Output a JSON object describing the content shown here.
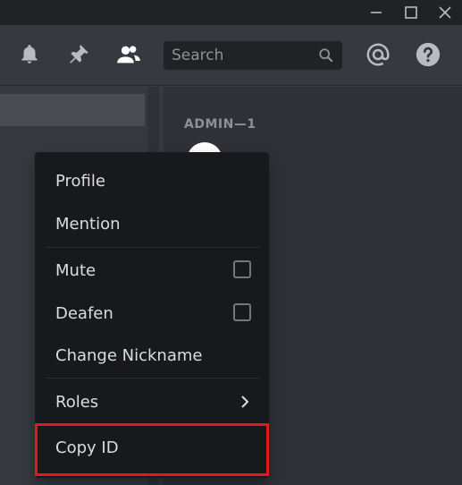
{
  "window": {
    "icons": [
      "minimize-icon",
      "maximize-icon",
      "close-icon"
    ]
  },
  "toolbar": {
    "icons": [
      "bell-icon",
      "pin-icon",
      "members-icon",
      "mention-icon",
      "help-icon"
    ],
    "search": {
      "placeholder": "Search",
      "value": ""
    }
  },
  "members": {
    "group_header": "ADMIN—1"
  },
  "context_menu": {
    "items": [
      {
        "label": "Profile"
      },
      {
        "label": "Mention"
      },
      {
        "label": "Mute",
        "checkbox": false
      },
      {
        "label": "Deafen",
        "checkbox": false
      },
      {
        "label": "Change Nickname"
      },
      {
        "label": "Roles",
        "has_submenu": true
      },
      {
        "label": "Copy ID",
        "highlighted": true
      }
    ]
  },
  "colors": {
    "background": "#36393f",
    "titlebar": "#202225",
    "menu": "#18191c",
    "highlight_border": "#e01b1b",
    "text": "#dcddde"
  }
}
